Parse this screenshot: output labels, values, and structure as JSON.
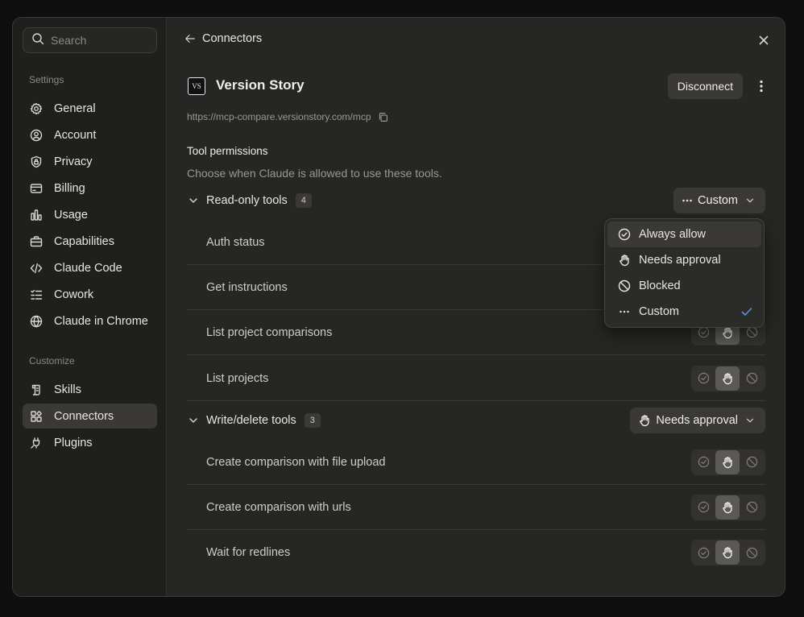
{
  "sidebar": {
    "search_placeholder": "Search",
    "settings_label": "Settings",
    "customize_label": "Customize",
    "settings_items": [
      {
        "label": "General",
        "icon": "gear-icon"
      },
      {
        "label": "Account",
        "icon": "user-circle-icon"
      },
      {
        "label": "Privacy",
        "icon": "shield-lock-icon"
      },
      {
        "label": "Billing",
        "icon": "credit-card-icon"
      },
      {
        "label": "Usage",
        "icon": "bar-chart-icon"
      },
      {
        "label": "Capabilities",
        "icon": "briefcase-icon"
      },
      {
        "label": "Claude Code",
        "icon": "code-icon"
      },
      {
        "label": "Cowork",
        "icon": "checklist-icon"
      },
      {
        "label": "Claude in Chrome",
        "icon": "globe-icon"
      }
    ],
    "customize_items": [
      {
        "label": "Skills",
        "icon": "scroll-icon"
      },
      {
        "label": "Connectors",
        "icon": "blocks-icon",
        "active": true
      },
      {
        "label": "Plugins",
        "icon": "plug-icon"
      }
    ]
  },
  "header": {
    "back_label": "Connectors"
  },
  "connector": {
    "logo_text": "VS",
    "name": "Version Story",
    "disconnect_label": "Disconnect",
    "url": "https://mcp-compare.versionstory.com/mcp"
  },
  "permissions": {
    "title": "Tool permissions",
    "description": "Choose when Claude is allowed to use these tools.",
    "groups": [
      {
        "name": "Read-only tools",
        "count": "4",
        "setting": "Custom",
        "tools": [
          "Auth status",
          "Get instructions",
          "List project comparisons",
          "List projects"
        ]
      },
      {
        "name": "Write/delete tools",
        "count": "3",
        "setting": "Needs approval",
        "tools": [
          "Create comparison with file upload",
          "Create comparison with urls",
          "Wait for redlines"
        ]
      }
    ],
    "tool_selected_option": "Needs approval"
  },
  "dropdown": {
    "options": [
      {
        "label": "Always allow",
        "icon": "check-circle-icon"
      },
      {
        "label": "Needs approval",
        "icon": "hand-icon"
      },
      {
        "label": "Blocked",
        "icon": "blocked-icon"
      },
      {
        "label": "Custom",
        "icon": "dots-icon",
        "checked": true
      }
    ]
  },
  "colors": {
    "background": "#262624",
    "sidebar": "#1f1f1e",
    "accent_check": "#5a8fd8"
  }
}
